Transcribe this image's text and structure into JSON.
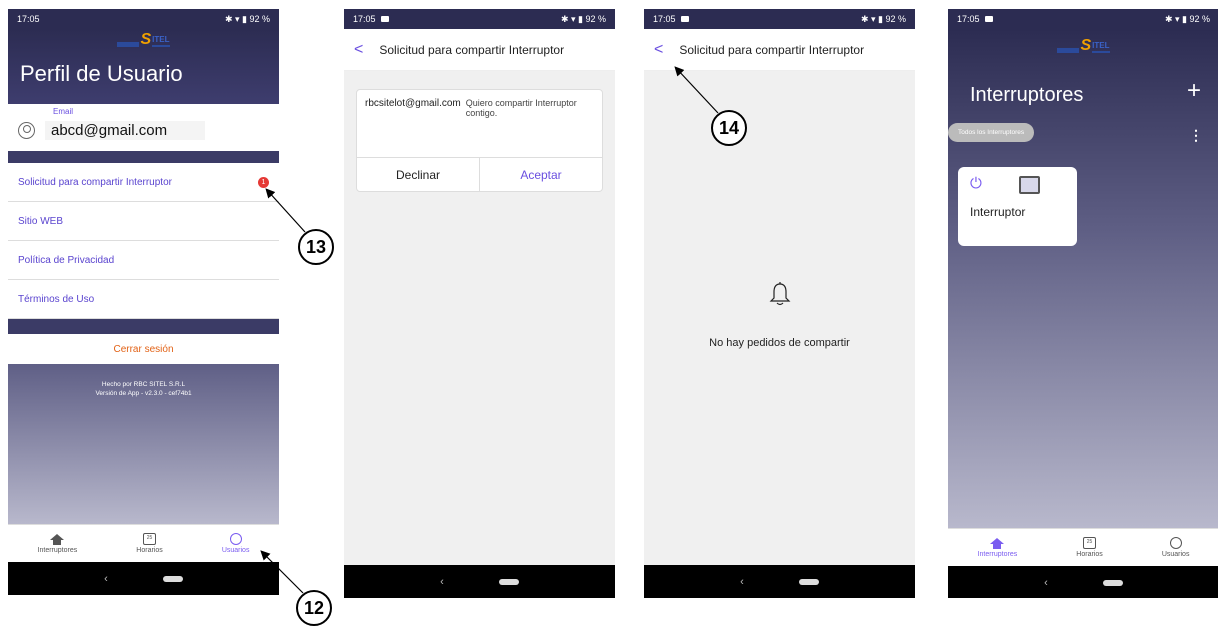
{
  "status_time": "17:05",
  "status_right": "✱ ▾ ▮ 92 %",
  "logo": {
    "prefix": "",
    "s": "S",
    "suffix": "ITEL"
  },
  "phone1": {
    "title": "Perfil de Usuario",
    "email_label": "Email",
    "email_value": "abcd@gmail.com",
    "menu": [
      {
        "label": "Solicitud para compartir Interruptor",
        "badge": "1"
      },
      {
        "label": "Sitio WEB"
      },
      {
        "label": "Política de Privacidad"
      },
      {
        "label": "Términos de Uso"
      }
    ],
    "logout": "Cerrar sesión",
    "footer_line1": "Hecho por RBC SITEL S.R.L",
    "footer_line2": "Versión de App - v2.3.0 - cef74b1",
    "nav": [
      {
        "label": "Interruptores"
      },
      {
        "label": "Horarios",
        "cal": "25"
      },
      {
        "label": "Usuarios"
      }
    ]
  },
  "phone2": {
    "back": "<",
    "title": "Solicitud para compartir Interruptor",
    "sender": "rbcsitelot@gmail.com",
    "message": "Quiero compartir Interruptor contigo.",
    "decline": "Declinar",
    "accept": "Aceptar"
  },
  "phone3": {
    "back": "<",
    "title": "Solicitud para compartir Interruptor",
    "empty_text": "No hay pedidos de compartir"
  },
  "phone4": {
    "title": "Interruptores",
    "add": "+",
    "filter_chip": "Todos los Interruptores",
    "more": "⋮",
    "device_name": "Interruptor",
    "power_symbol": "⏻",
    "nav": [
      {
        "label": "Interruptores"
      },
      {
        "label": "Horarios",
        "cal": "25"
      },
      {
        "label": "Usuarios"
      }
    ]
  },
  "system_nav": {
    "back": "‹"
  },
  "callouts": {
    "c12": "12",
    "c13": "13",
    "c14": "14"
  },
  "colors": {
    "accent": "#6a4fe0",
    "header": "#2c2c52",
    "logout": "#e26216",
    "badge": "#e53935"
  }
}
